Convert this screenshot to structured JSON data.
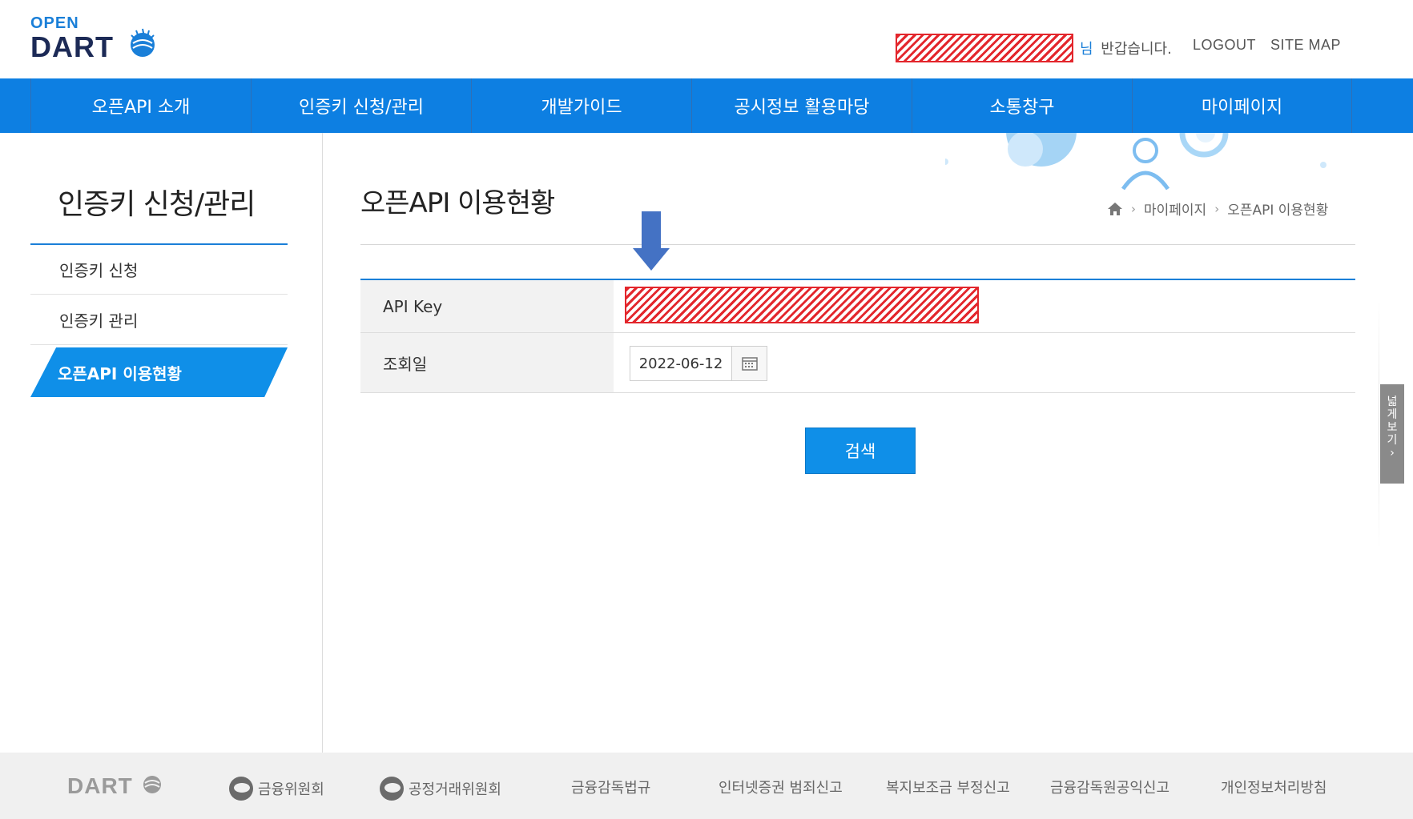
{
  "header": {
    "logo_open": "OPEN",
    "logo_dart": "DART",
    "greeting_nim": "님",
    "greeting_text": "반갑습니다.",
    "logout": "LOGOUT",
    "sitemap": "SITE MAP"
  },
  "gnb": [
    "오픈API 소개",
    "인증키 신청/관리",
    "개발가이드",
    "공시정보 활용마당",
    "소통창구",
    "마이페이지"
  ],
  "sidebar": {
    "title": "인증키 신청/관리",
    "items": [
      {
        "label": "인증키 신청"
      },
      {
        "label": "인증키 관리"
      },
      {
        "label": "오픈API 이용현황"
      }
    ]
  },
  "main": {
    "title": "오픈API 이용현황",
    "breadcrumb": [
      "마이페이지",
      "오픈API 이용현황"
    ],
    "form": {
      "api_key_label": "API Key",
      "date_label": "조회일",
      "date_value": "2022-06-12"
    },
    "search_button": "검색",
    "wide_view": [
      "넓",
      "게",
      "보",
      "기",
      "›"
    ]
  },
  "footer": {
    "logo": "DART",
    "links": [
      "금융위원회",
      "공정거래위원회",
      "금융감독법규",
      "인터넷증권 범죄신고",
      "복지보조금 부정신고",
      "금융감독원공익신고",
      "개인정보처리방침"
    ]
  },
  "colors": {
    "primary": "#0d7fe2",
    "accent": "#0f8fe8",
    "redaction": "#e3262c",
    "footer_bg": "#f0f0f0"
  }
}
